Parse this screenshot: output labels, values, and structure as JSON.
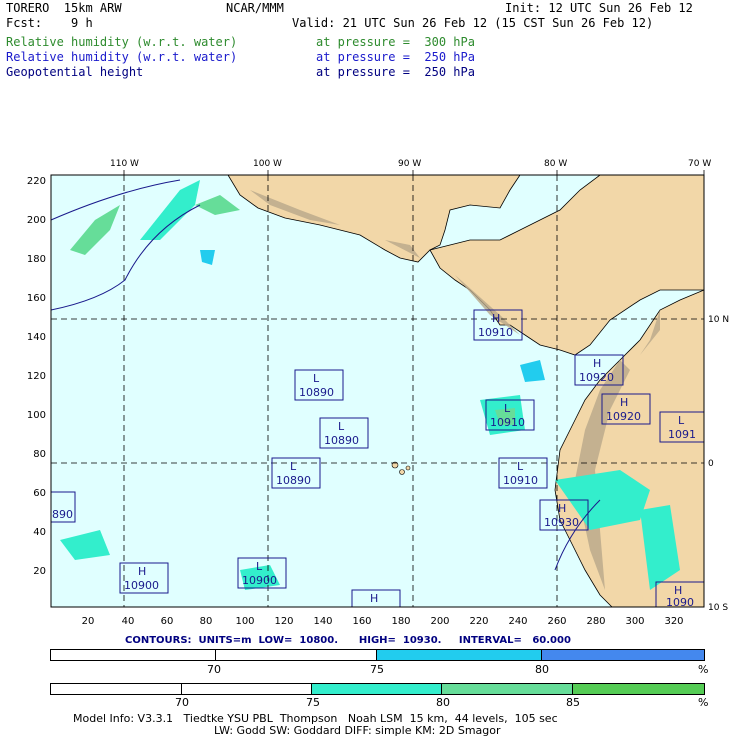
{
  "header": {
    "model": "TORERO  15km ARW",
    "org": "NCAR/MMM",
    "init": "Init: 12 UTC Sun 26 Feb 12",
    "fcst": "Fcst:    9 h",
    "valid": "Valid: 21 UTC Sun 26 Feb 12 (15 CST Sun 26 Feb 12)",
    "fields": [
      {
        "name": "Relative humidity (w.r.t. water)",
        "level": "at pressure =  300 hPa",
        "color": "#2e8b2e"
      },
      {
        "name": "Relative humidity (w.r.t. water)",
        "level": "at pressure =  250 hPa",
        "color": "#1a1acc"
      },
      {
        "name": "Geopotential height",
        "level": "at pressure =  250 hPa",
        "color": "#000080"
      }
    ]
  },
  "map": {
    "top_lon_labels": [
      "110 W",
      "100 W",
      "90 W",
      "80 W",
      "70 W"
    ],
    "right_lat_labels": [
      "10 N",
      "0",
      "10 S"
    ],
    "left_y_ticks": [
      "220",
      "200",
      "180",
      "160",
      "140",
      "120",
      "100",
      "80",
      "60",
      "40",
      "20"
    ],
    "bottom_x_ticks": [
      "20",
      "40",
      "60",
      "80",
      "100",
      "120",
      "140",
      "160",
      "180",
      "200",
      "220",
      "240",
      "260",
      "280",
      "300",
      "320"
    ],
    "contour_labels": [
      {
        "type": "H",
        "value": "10910"
      },
      {
        "type": "L",
        "value": "10890"
      },
      {
        "type": "L",
        "value": "10890"
      },
      {
        "type": "L",
        "value": "10890"
      },
      {
        "type": "H",
        "value": "10920"
      },
      {
        "type": "H",
        "value": "10920"
      },
      {
        "type": "L",
        "value": "10910"
      },
      {
        "type": "L",
        "value": "10910"
      },
      {
        "type": "L",
        "value": "1091"
      },
      {
        "type": "H",
        "value": "10930"
      },
      {
        "type": "H",
        "value": "10900"
      },
      {
        "type": "L",
        "value": "10900"
      },
      {
        "type": "H",
        "value": ""
      },
      {
        "type": "H",
        "value": "1090"
      },
      {
        "type": "",
        "value": "890"
      }
    ],
    "colors": {
      "ocean": "#e0ffff",
      "land": "#f2d7a8",
      "mountain": "#b8a88a"
    }
  },
  "contour_info": {
    "text": "CONTOURS:  UNITS=m  LOW=  10800.      HIGH=  10930.     INTERVAL=   60.000"
  },
  "colorbar1": {
    "labels": [
      "70",
      "75",
      "80",
      "%"
    ],
    "colors": [
      "#ffffff",
      "#ffffff",
      "#22ccee",
      "#4488ee"
    ]
  },
  "colorbar2": {
    "labels": [
      "70",
      "75",
      "80",
      "85",
      "%"
    ],
    "colors": [
      "#ffffff",
      "#ffffff",
      "#33eecc",
      "#66dd99",
      "#55cc55"
    ]
  },
  "footer": {
    "line1": "Model Info: V3.3.1   Tiedtke YSU PBL  Thompson   Noah LSM  15 km,  44 levels,  105 sec",
    "line2": "LW: Godd SW: Goddard DIFF: simple KM: 2D Smagor"
  }
}
